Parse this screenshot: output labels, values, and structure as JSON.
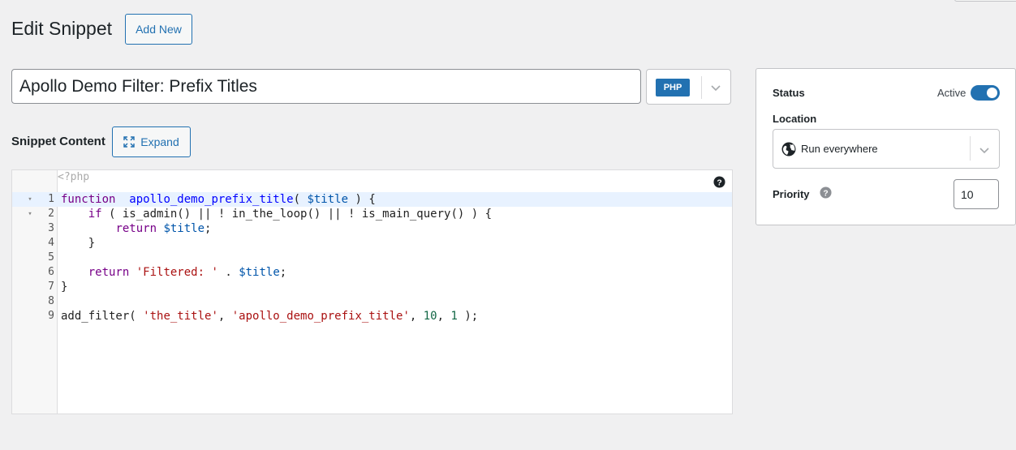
{
  "header": {
    "title": "Edit Snippet",
    "add_new_label": "Add New"
  },
  "snippet": {
    "title_value": "Apollo Demo Filter: Prefix Titles",
    "type_badge": "PHP",
    "content_label": "Snippet Content",
    "expand_label": "Expand"
  },
  "editor": {
    "php_open": "<?php",
    "active_line": 1,
    "lines": [
      {
        "n": "1",
        "fold": true,
        "tokens": [
          [
            "kw",
            "function"
          ],
          [
            "",
            "  "
          ],
          [
            "fn",
            "apollo_demo_prefix_title"
          ],
          [
            "",
            "( "
          ],
          [
            "var",
            "$title"
          ],
          [
            "",
            " ) {"
          ]
        ]
      },
      {
        "n": "2",
        "fold": true,
        "tokens": [
          [
            "",
            "    "
          ],
          [
            "kw",
            "if"
          ],
          [
            "",
            " ( is_admin() || ! in_the_loop() || ! is_main_query() ) {"
          ]
        ]
      },
      {
        "n": "3",
        "fold": false,
        "tokens": [
          [
            "",
            "        "
          ],
          [
            "kw",
            "return"
          ],
          [
            "",
            " "
          ],
          [
            "var",
            "$title"
          ],
          [
            "",
            ";"
          ]
        ]
      },
      {
        "n": "4",
        "fold": false,
        "tokens": [
          [
            "",
            "    }"
          ]
        ]
      },
      {
        "n": "5",
        "fold": false,
        "tokens": []
      },
      {
        "n": "6",
        "fold": false,
        "tokens": [
          [
            "",
            "    "
          ],
          [
            "kw",
            "return"
          ],
          [
            "",
            " "
          ],
          [
            "str",
            "'Filtered: '"
          ],
          [
            "",
            " . "
          ],
          [
            "var",
            "$title"
          ],
          [
            "",
            ";"
          ]
        ]
      },
      {
        "n": "7",
        "fold": false,
        "tokens": [
          [
            "",
            "}"
          ]
        ]
      },
      {
        "n": "8",
        "fold": false,
        "tokens": []
      },
      {
        "n": "9",
        "fold": false,
        "tokens": [
          [
            "",
            "add_filter( "
          ],
          [
            "str",
            "'the_title'"
          ],
          [
            "",
            ", "
          ],
          [
            "str",
            "'apollo_demo_prefix_title'"
          ],
          [
            "",
            ", "
          ],
          [
            "num",
            "10"
          ],
          [
            "",
            ", "
          ],
          [
            "num",
            "1"
          ],
          [
            "",
            " );"
          ]
        ]
      }
    ]
  },
  "sidebar": {
    "status_label": "Status",
    "status_value": "Active",
    "location_label": "Location",
    "location_value": "Run everywhere",
    "priority_label": "Priority",
    "priority_value": "10"
  },
  "colors": {
    "accent": "#2271b1",
    "active_line": "#e8f2ff"
  },
  "icons": [
    "chevron-down-icon",
    "expand-icon",
    "help-icon",
    "globe-icon"
  ]
}
